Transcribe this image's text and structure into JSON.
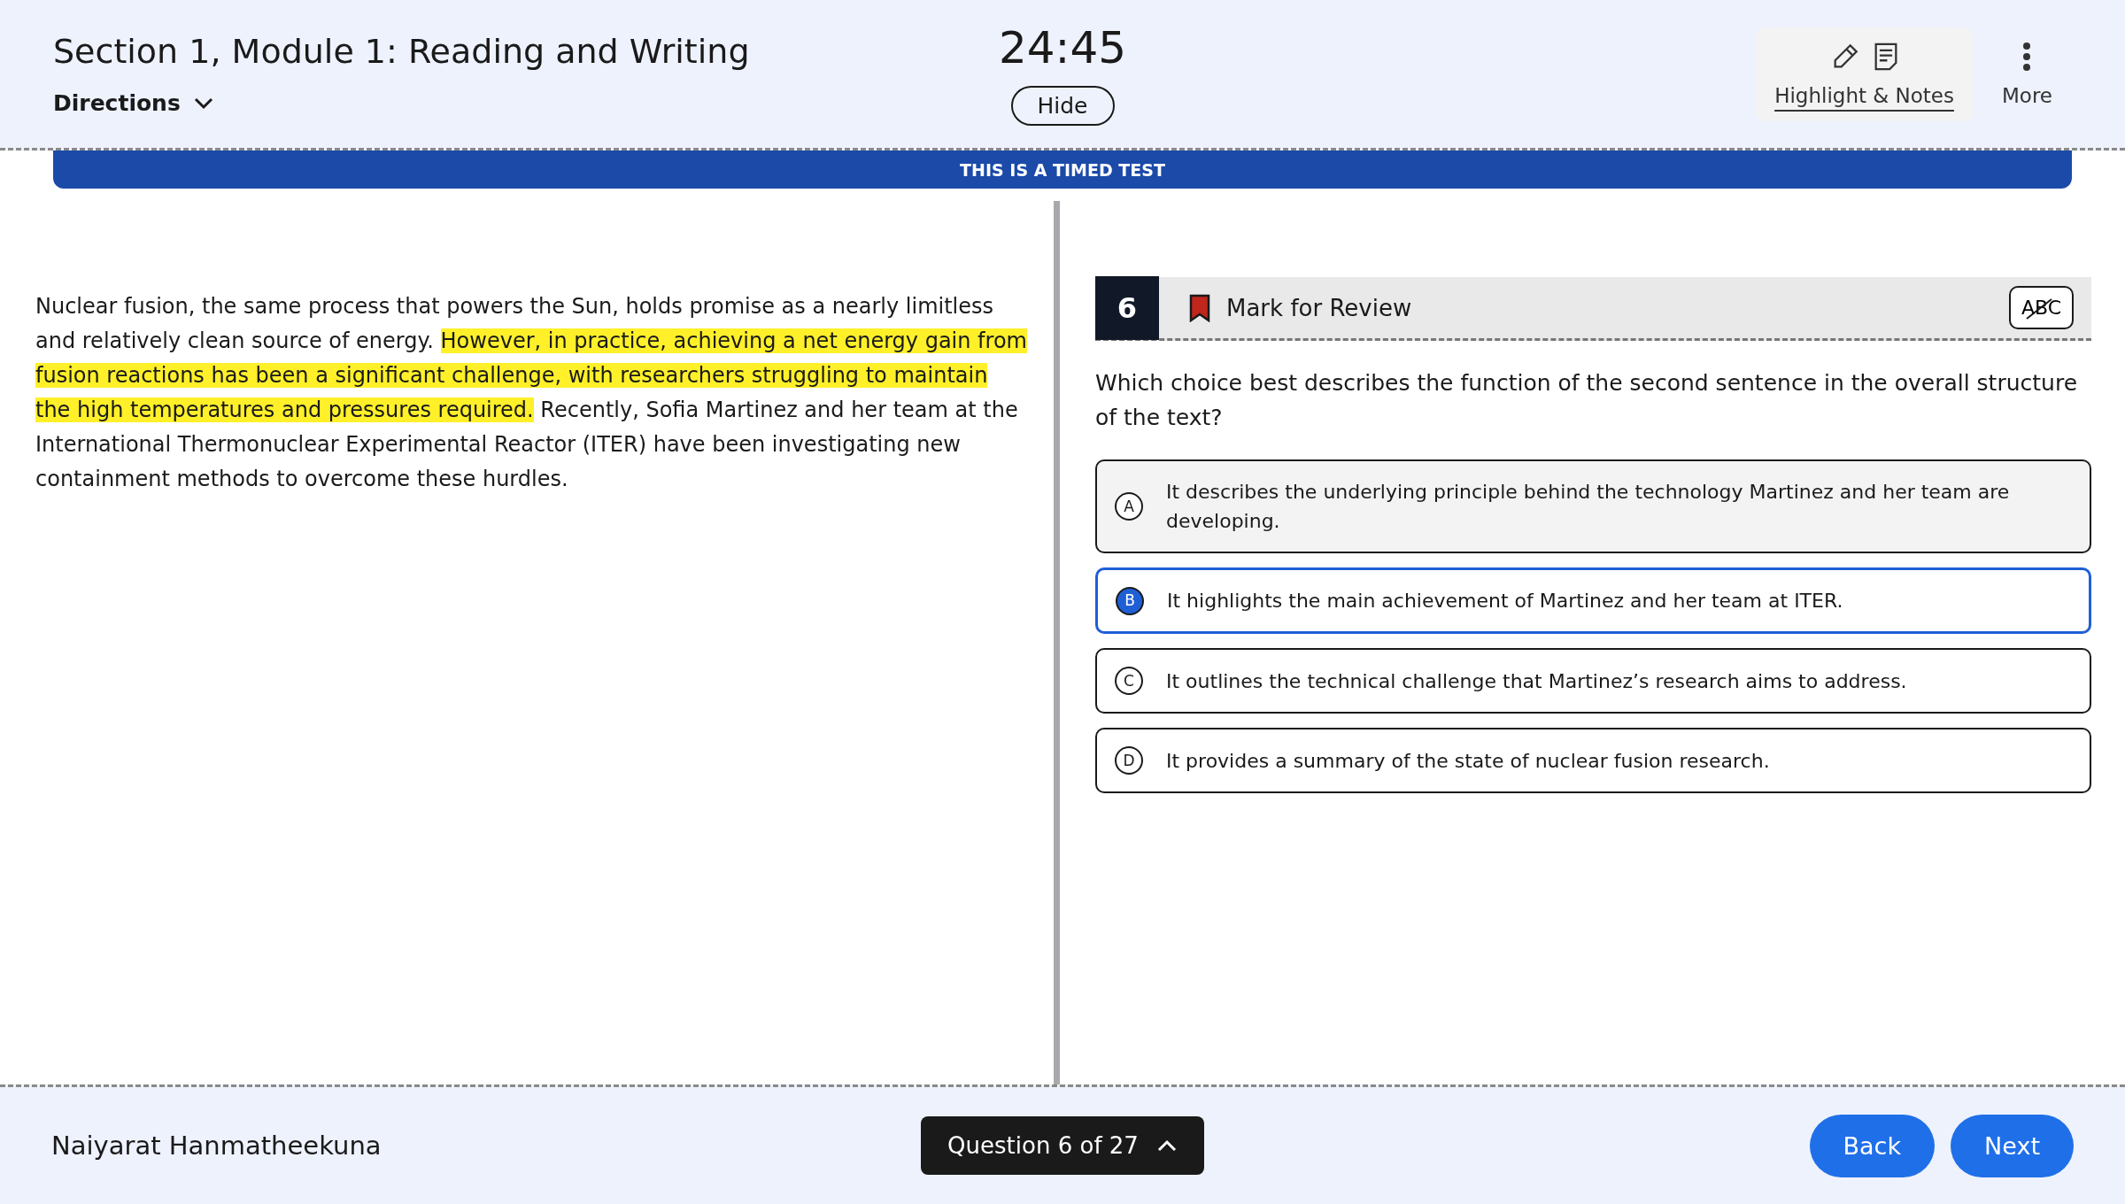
{
  "header": {
    "title": "Section 1, Module 1: Reading and Writing",
    "directions": "Directions",
    "timer": "24:45",
    "hide": "Hide",
    "tools": [
      {
        "kind": "highlight",
        "label": "Highlight & Notes"
      },
      {
        "kind": "more",
        "label": "More"
      }
    ]
  },
  "banner": "THIS IS A TIMED TEST",
  "passage": [
    {
      "text": "Nuclear fusion, the same process that powers the Sun, holds promise as a nearly limitless and relatively clean source of energy. ",
      "highlighted": false
    },
    {
      "text": "However, in practice, achieving a net energy gain from fusion reactions has been a significant challenge, with researchers struggling to maintain the high temperatures and pressures required.",
      "highlighted": true
    },
    {
      "text": " Recently, Sofia Martinez and her team at the International Thermonuclear Experimental Reactor (ITER) have been investigating new containment methods to overcome these hurdles.",
      "highlighted": false
    }
  ],
  "question": {
    "number": "6",
    "mark_for_review": "Mark for Review",
    "marked": true,
    "eliminator": "ABC",
    "prompt": "Which choice best describes the function of the second sentence in the overall structure of the text?",
    "choices": [
      {
        "letter": "A",
        "text": "It describes the underlying principle behind the technology Martinez and her team are developing.",
        "selected": false,
        "hovered": true
      },
      {
        "letter": "B",
        "text": "It highlights the main achievement of Martinez and her team at ITER.",
        "selected": true,
        "hovered": false
      },
      {
        "letter": "C",
        "text": "It outlines the technical challenge that Martinez’s research aims to address.",
        "selected": false,
        "hovered": false
      },
      {
        "letter": "D",
        "text": "It provides a summary of the state of nuclear fusion research.",
        "selected": false,
        "hovered": false
      }
    ]
  },
  "footer": {
    "student": "Naiyarat Hanmatheekuna",
    "navigator": "Question 6 of 27",
    "back": "Back",
    "next": "Next"
  }
}
